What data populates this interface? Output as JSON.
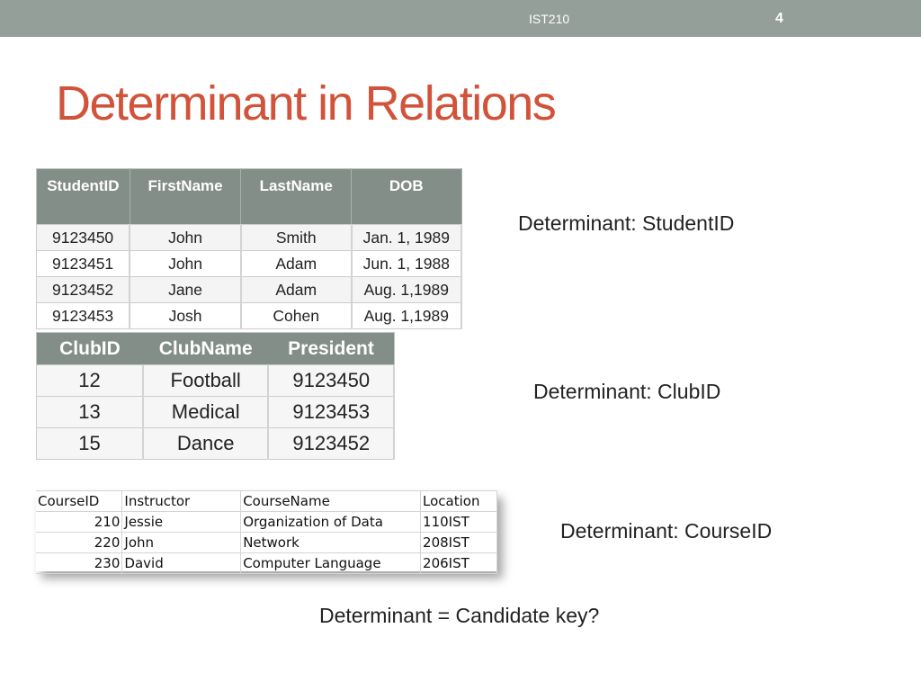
{
  "header": {
    "course": "IST210",
    "page_number": "4"
  },
  "title": "Determinant in Relations",
  "students_table": {
    "headers": [
      "StudentID",
      "FirstName",
      "LastName",
      "DOB"
    ],
    "rows": [
      [
        "9123450",
        "John",
        "Smith",
        "Jan. 1, 1989"
      ],
      [
        "9123451",
        "John",
        "Adam",
        "Jun. 1, 1988"
      ],
      [
        "9123452",
        "Jane",
        "Adam",
        "Aug. 1,1989"
      ],
      [
        "9123453",
        "Josh",
        "Cohen",
        "Aug. 1,1989"
      ]
    ]
  },
  "clubs_table": {
    "headers": [
      "ClubID",
      "ClubName",
      "President"
    ],
    "rows": [
      [
        "12",
        "Football",
        "9123450"
      ],
      [
        "13",
        "Medical",
        "9123453"
      ],
      [
        "15",
        "Dance",
        "9123452"
      ]
    ]
  },
  "courses_table": {
    "headers": [
      "CourseID",
      "Instructor",
      "CourseName",
      "Location"
    ],
    "rows": [
      [
        "210",
        "Jessie",
        "Organization of Data",
        "110IST"
      ],
      [
        "220",
        "John",
        "Network",
        "208IST"
      ],
      [
        "230",
        "David",
        "Computer Language",
        "206IST"
      ]
    ]
  },
  "determinants": {
    "student": "Determinant: StudentID",
    "club": "Determinant: ClubID",
    "course": "Determinant: CourseID"
  },
  "question": "Determinant = Candidate key?"
}
